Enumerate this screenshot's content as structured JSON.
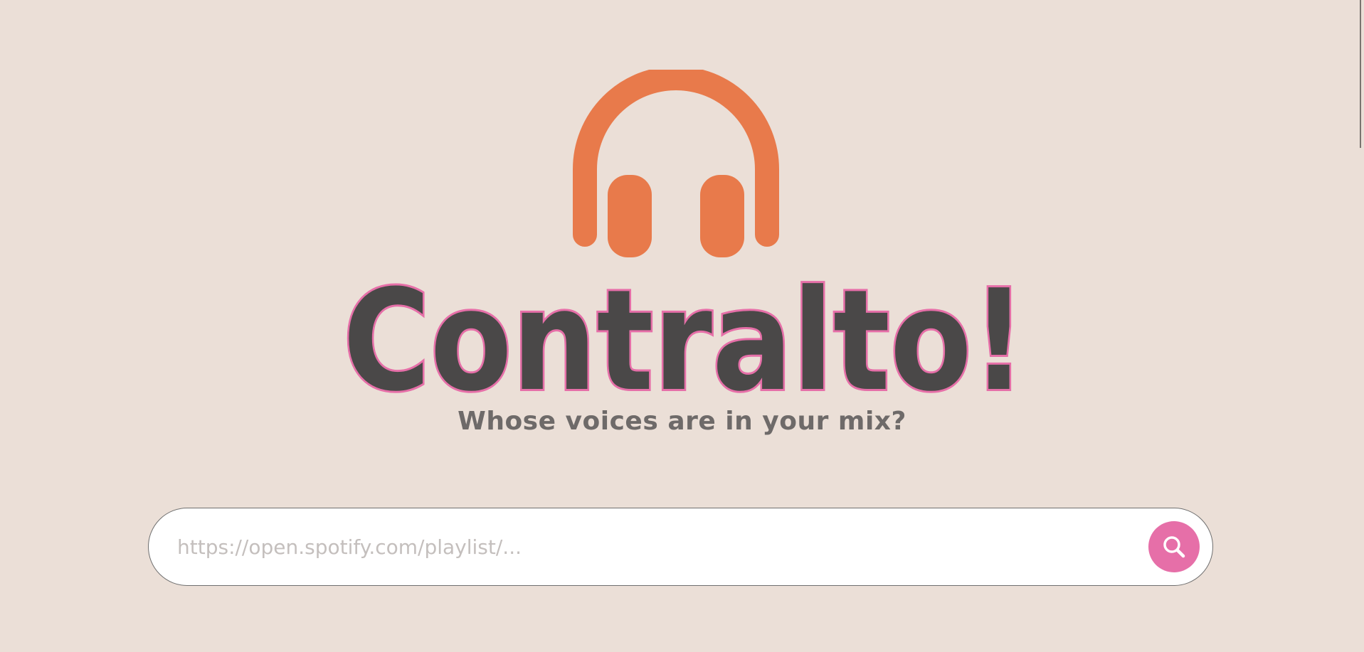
{
  "brand": {
    "logo_icon": "headphones-icon",
    "title": "Contralto!",
    "tagline": "Whose voices are in your mix?"
  },
  "search": {
    "placeholder": "https://open.spotify.com/playlist/...",
    "value": "",
    "button_icon": "search-icon"
  },
  "colors": {
    "background": "#ebdfd7",
    "accent_orange": "#e87a4b",
    "accent_pink": "#e66fa8",
    "title_fill": "#4a4848",
    "tagline": "#6e6a69"
  }
}
